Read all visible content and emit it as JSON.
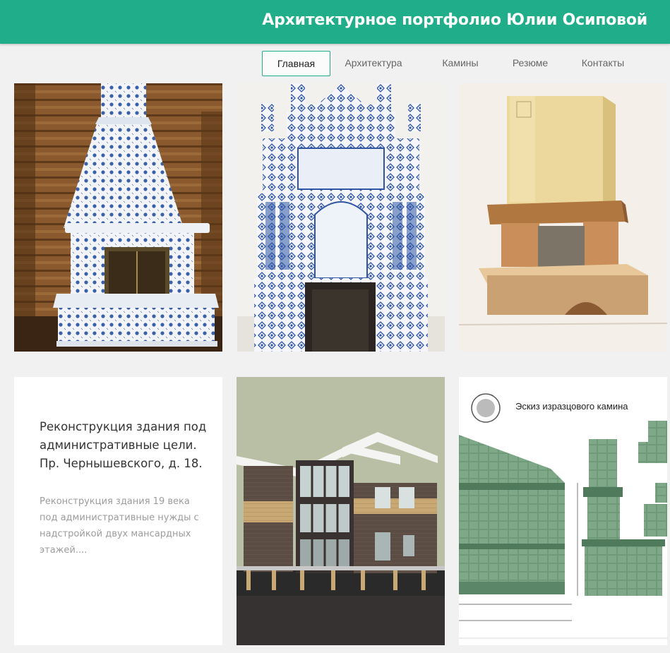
{
  "site": {
    "title": "Архитектурное портфолио Юлии Осиповой"
  },
  "nav": {
    "items": [
      {
        "label": "Главная",
        "active": true
      },
      {
        "label": "Архитектура",
        "active": false
      },
      {
        "label": "Камины",
        "active": false
      },
      {
        "label": "Резюме",
        "active": false
      },
      {
        "label": "Контакты",
        "active": false
      }
    ]
  },
  "colors": {
    "brand": "#1fae89",
    "background": "#f1f1f1"
  },
  "gallery": {
    "row1": [
      {
        "subject": "blue-white tiled fireplace in log interior"
      },
      {
        "subject": "ornate blue-white tiled stove"
      },
      {
        "subject": "watercolor fireplace sketch"
      }
    ],
    "card": {
      "title": "Реконструкция здания под административные цели. Пр. Чернышевского, д. 18.",
      "excerpt": "Реконструкция здания 19 века под административные нужды с надстройкой двух мансардных этажей...."
    },
    "row2": [
      {
        "subject": "3D render of brick house"
      },
      {
        "subject": "green tiled fireplace drawing",
        "caption": "Эскиз изразцового камина"
      }
    ]
  }
}
